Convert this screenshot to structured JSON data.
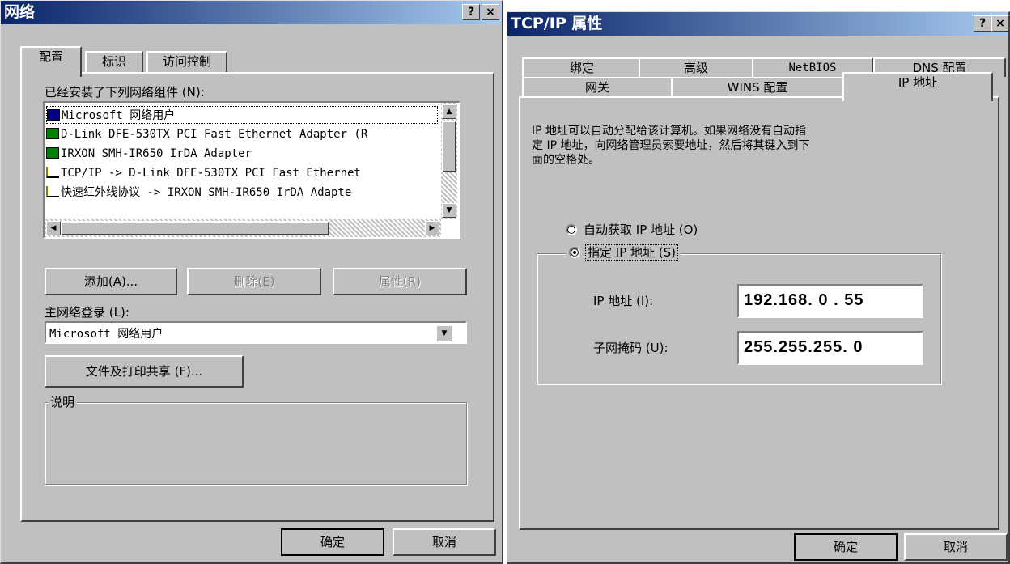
{
  "left": {
    "title": "网络",
    "help": "?",
    "close": "×",
    "tabs": [
      "配置",
      "标识",
      "访问控制"
    ],
    "installed_label": "已经安装了下列网络组件 (N):",
    "components": [
      {
        "icon": "computer-icon",
        "text": "Microsoft 网络用户"
      },
      {
        "icon": "network-adapter-icon",
        "text": "D-Link DFE-530TX PCI Fast Ethernet Adapter (R"
      },
      {
        "icon": "network-adapter-icon",
        "text": "IRXON SMH-IR650 IrDA Adapter"
      },
      {
        "icon": "protocol-icon",
        "text": "TCP/IP -> D-Link DFE-530TX PCI Fast Ethernet"
      },
      {
        "icon": "protocol-icon",
        "text": "快速红外线协议 -> IRXON SMH-IR650 IrDA Adapte"
      }
    ],
    "buttons": {
      "add": "添加(A)...",
      "remove": "删除(E)",
      "properties": "属性(R)"
    },
    "logon_label": "主网络登录 (L):",
    "logon_value": "Microsoft 网络用户",
    "file_share": "文件及打印共享 (F)...",
    "desc_label": "说明",
    "ok": "确定",
    "cancel": "取消"
  },
  "right": {
    "title": "TCP/IP 属性",
    "help": "?",
    "close": "×",
    "tabs_row1": [
      "绑定",
      "高级",
      "NetBIOS",
      "DNS 配置"
    ],
    "tabs_row2": [
      "网关",
      "WINS 配置",
      "IP 地址"
    ],
    "desc_line1": "IP 地址可以自动分配给该计算机。如果网络没有自动指",
    "desc_line2": "定 IP 地址，向网络管理员索要地址，然后将其键入到下",
    "desc_line3": "面的空格处。",
    "radio_auto": "自动获取 IP 地址 (O)",
    "radio_specify": "指定 IP 地址 (S)",
    "ip_label": "IP 地址 (I):",
    "ip_value": "192.168. 0 . 55",
    "mask_label": "子网掩码 (U):",
    "mask_value": "255.255.255. 0",
    "ok": "确定",
    "cancel": "取消"
  }
}
